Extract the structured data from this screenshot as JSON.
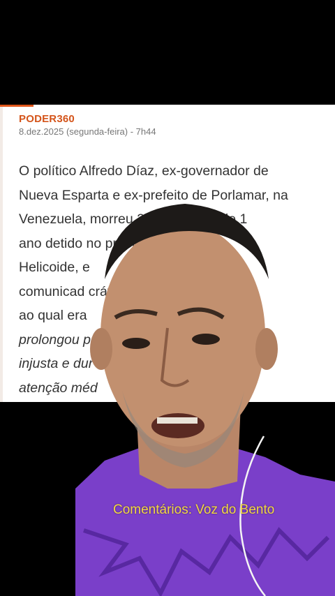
{
  "article": {
    "source": "PODER360",
    "date": "8.dez.2025 (segunda-feira) - 7h44",
    "lines": [
      {
        "text": "O político Alfredo Díaz, ex-governador de",
        "italic": false
      },
      {
        "text": "Nueva Esparta e ex-prefeito de Porlamar, na",
        "italic": false
      },
      {
        "text": "Venezuela, morreu 2 dias depois de 1",
        "italic": false
      },
      {
        "text": "ano detido no presídio de El",
        "italic": false
      },
      {
        "text": "Helicoide, e",
        "italic": false
      },
      {
        "text": "comunicad                          crática,",
        "italic": false
      },
      {
        "text": "ao qual era",
        "italic": false
      },
      {
        "text": "prolongou p                          a",
        "italic": true
      },
      {
        "text": "injusta e dur                          eu a",
        "italic": true
      },
      {
        "text": "atenção méd",
        "italic": true
      }
    ]
  },
  "overlay": {
    "caption": "Comentários: Voz do Bento"
  },
  "colors": {
    "accent": "#e0561b",
    "caption": "#f3d743",
    "shirt": "#7a3fc9"
  }
}
